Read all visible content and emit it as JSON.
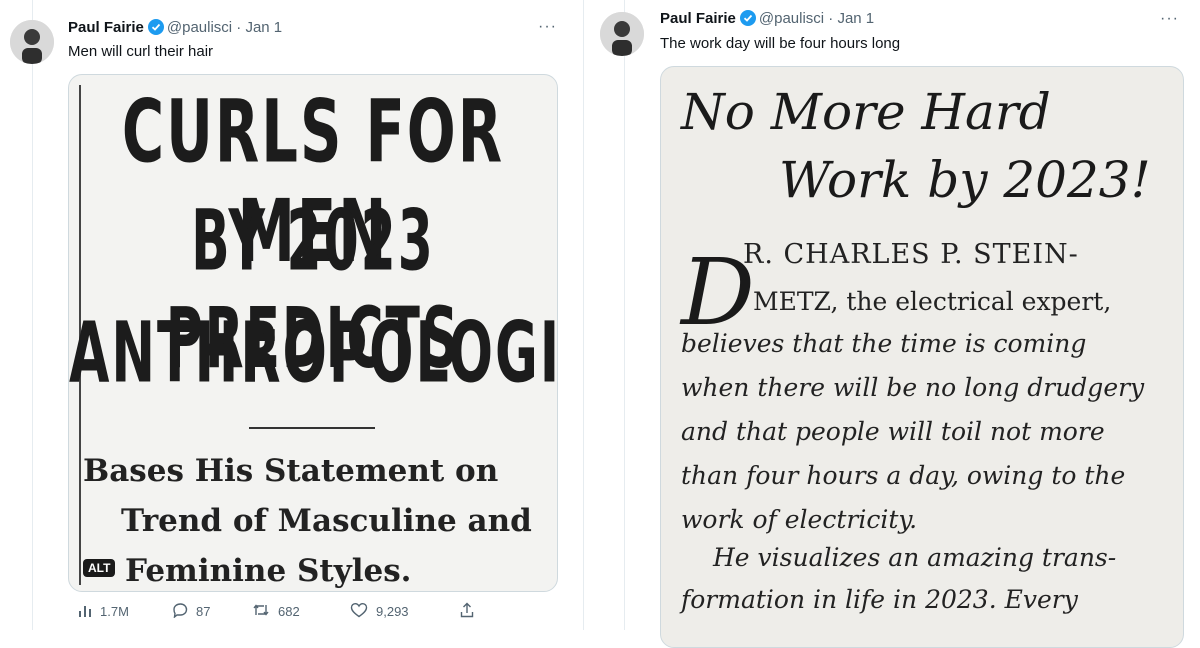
{
  "tweets": [
    {
      "author_name": "Paul Fairie",
      "handle_and_date": "@paulisci · Jan 1",
      "more": "···",
      "text": "Men will curl their hair",
      "clipping": {
        "headline": [
          "CURLS FOR MEN",
          "BY 2023 PREDICTS",
          "ANTHROPOLOGIST"
        ],
        "subhead": [
          "Bases His Statement on",
          "Trend of Masculine and",
          "Feminine Styles."
        ],
        "alt_badge": "ALT"
      },
      "actions": {
        "views": "1.7M",
        "replies": "87",
        "retweets": "682",
        "likes": "9,293"
      },
      "icons": [
        "avatar",
        "verified-icon",
        "more-icon",
        "views-icon",
        "reply-icon",
        "retweet-icon",
        "like-icon",
        "share-icon"
      ]
    },
    {
      "author_name": "Paul Fairie",
      "handle_and_date": "@paulisci · Jan 1",
      "more": "···",
      "text": "The work day will be four hours long",
      "clipping": {
        "title": [
          "No More Hard",
          "Work by 2023!"
        ],
        "drop_cap": "D",
        "lines": [
          "R. CHARLES P. STEIN-",
          "METZ, the electrical expert,",
          "believes that the time is coming",
          "when there will be no long drudgery",
          "and that people will toil not more",
          "than four hours a day, owing to the",
          "work of electricity.",
          "He visualizes an amazing trans-",
          "formation in life in 2023. Every"
        ]
      }
    }
  ],
  "colors": {
    "verified": "#1d9bf0",
    "secondary_text": "#536471",
    "divider": "#e6ecf0"
  }
}
